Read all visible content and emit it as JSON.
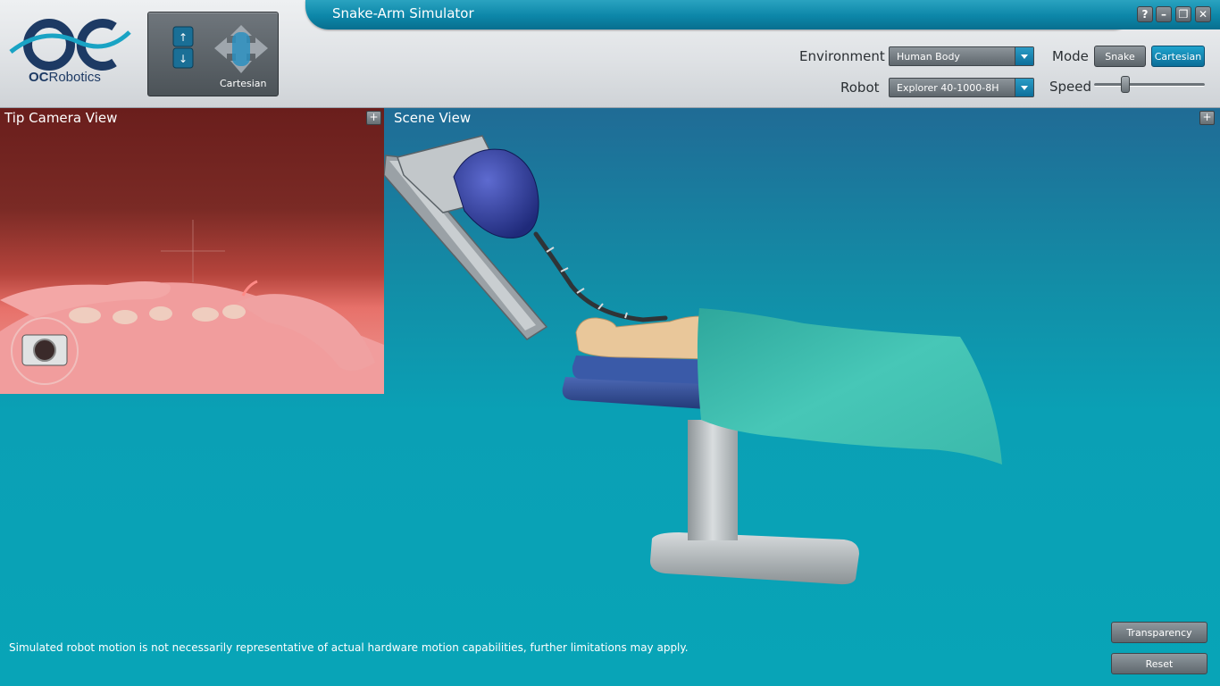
{
  "window": {
    "title": "Snake-Arm Simulator",
    "buttons": {
      "help": "?",
      "minimize": "–",
      "restore": "❐",
      "close": "✕"
    }
  },
  "logo": {
    "brand_bold": "OC",
    "brand_rest": "Robotics"
  },
  "mode_indicator": {
    "label": "Cartesian"
  },
  "controls": {
    "environment": {
      "label": "Environment",
      "value": "Human Body"
    },
    "robot": {
      "label": "Robot",
      "value": "Explorer 40-1000-8H"
    },
    "mode": {
      "label": "Mode",
      "options": [
        "Snake",
        "Cartesian"
      ],
      "selected": "Cartesian"
    },
    "speed": {
      "label": "Speed",
      "value_fraction": 0.25
    }
  },
  "tip_view": {
    "title": "Tip Camera View",
    "expand": "+"
  },
  "scene_view": {
    "title": "Scene View",
    "expand": "+"
  },
  "footer": {
    "disclaimer": "Simulated robot motion is not necessarily representative of actual hardware motion capabilities, further limitations may apply.",
    "transparency_button": "Transparency",
    "reset_button": "Reset"
  },
  "colors": {
    "accent": "#0c86a8",
    "scene_bottom": "#08a4b7",
    "scene_top": "#1f5a86",
    "drape": "#3fc0b2",
    "arm_body": "#2e3a8f"
  }
}
